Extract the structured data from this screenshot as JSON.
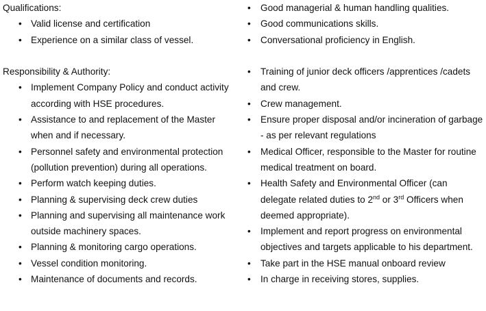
{
  "qualifications": {
    "heading": "Qualifications:",
    "items": [
      "Valid license and certification",
      "Experience on a similar class of vessel."
    ],
    "right_items": [
      "Good managerial & human handling qualities.",
      "Good communications skills.",
      "Conversational proficiency in English."
    ]
  },
  "responsibility": {
    "heading": "Responsibility & Authority:",
    "left_items": [
      "Implement Company Policy and conduct activity according with HSE procedures.",
      "Assistance to and replacement of the Master when and if necessary.",
      "Personnel safety and environmental protection (pollution prevention) during all operations.",
      "Perform watch keeping duties.",
      "Planning & supervising deck crew duties",
      "Planning and supervising all maintenance work outside machinery spaces.",
      "Planning & monitoring cargo operations.",
      "Vessel condition monitoring.",
      "Maintenance of documents and records."
    ],
    "right_items": [
      "Training of junior deck officers /apprentices /cadets and crew.",
      "Crew management.",
      "Ensure proper disposal and/or incineration of garbage - as per relevant regulations",
      "Medical Officer, responsible to the Master for routine medical treatment on board."
    ],
    "hse_officer": {
      "text_a": "Health Safety and Environmental Officer (can delegate related duties to 2",
      "sup_a": "nd",
      "text_b": " or 3",
      "sup_b": "rd",
      "text_c": " Officers when deemed appropriate)."
    },
    "right_items_tail": [
      "Implement and report progress on environmental objectives and targets applicable to his department.",
      "Take part in the HSE manual onboard review",
      "In charge in receiving stores, supplies."
    ]
  }
}
